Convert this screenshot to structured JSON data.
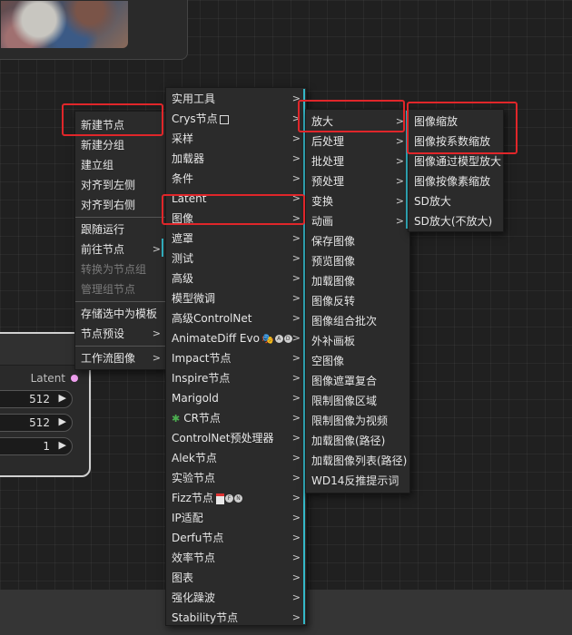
{
  "latent_node": {
    "output_label": "Latent",
    "width_value": "512",
    "height_value": "512",
    "batch_value": "1"
  },
  "menu1": {
    "items": [
      "新建节点",
      "新建分组",
      "建立组",
      "对齐到左侧",
      "对齐到右侧",
      "跟随运行",
      "前往节点",
      "转换为节点组",
      "管理组节点",
      "存储选中为模板",
      "节点预设",
      "工作流图像"
    ]
  },
  "menu2": {
    "items": [
      "实用工具",
      "Crys节点",
      "采样",
      "加载器",
      "条件",
      "Latent",
      "图像",
      "遮罩",
      "测试",
      "高级",
      "模型微调",
      "高级ControlNet",
      "AnimateDiff Evo",
      "Impact节点",
      "Inspire节点",
      "Marigold",
      "CR节点",
      "ControlNet预处理器",
      "Alek节点",
      "实验节点",
      "Fizz节点",
      "IP适配",
      "Derfu节点",
      "效率节点",
      "图表",
      "强化躁波",
      "Stability节点"
    ]
  },
  "menu3": {
    "items": [
      "放大",
      "后处理",
      "批处理",
      "预处理",
      "变换",
      "动画",
      "保存图像",
      "预览图像",
      "加载图像",
      "图像反转",
      "图像组合批次",
      "外补画板",
      "空图像",
      "图像遮罩复合",
      "限制图像区域",
      "限制图像为视频",
      "加载图像(路径)",
      "加载图像列表(路径)",
      "WD14反推提示词"
    ]
  },
  "menu4": {
    "items": [
      "图像缩放",
      "图像按系数缩放",
      "图像通过模型放大",
      "图像按像素缩放",
      "SD放大",
      "SD放大(不放大)"
    ]
  },
  "submenu_arrow": ">",
  "badges": {
    "animatediff": [
      "A",
      "D"
    ],
    "fizz": [
      "F",
      "N"
    ]
  },
  "colors": {
    "highlight_box": "#e0262a",
    "accent_bar": "#34b8c8",
    "menu_bg": "#2b2b2b",
    "latent_dot": "#f0a0f0"
  },
  "icons": {
    "run_arrow": "play-triangle-icon",
    "crys": "square-icon",
    "animatediff": "mask-emoji-icon",
    "cr": "puzzle-icon",
    "fizz": "calendar-icon"
  }
}
